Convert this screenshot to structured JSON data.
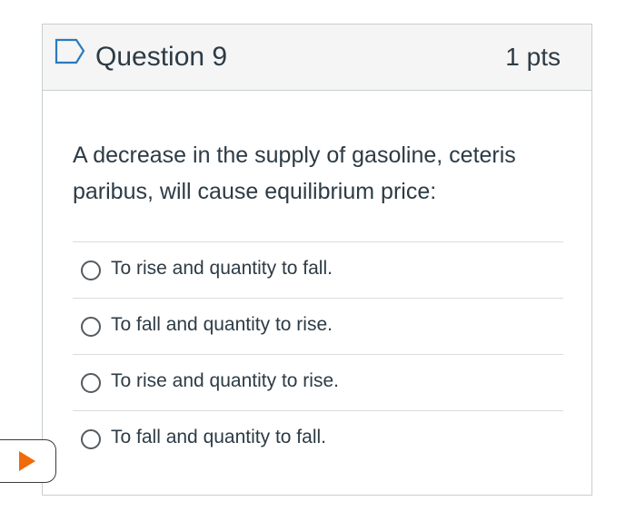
{
  "question": {
    "title": "Question 9",
    "points": "1 pts",
    "text": "A decrease in the supply of gasoline, ceteris paribus, will cause equilibrium price:",
    "flag_icon": "flag-outline-icon"
  },
  "answers": [
    {
      "label": "To rise and quantity to fall."
    },
    {
      "label": "To fall and quantity to rise."
    },
    {
      "label": "To rise and quantity to rise."
    },
    {
      "label": "To fall and quantity to fall."
    }
  ],
  "floating_control": {
    "icon": "play-icon",
    "accent_color": "#ef6a0a"
  }
}
